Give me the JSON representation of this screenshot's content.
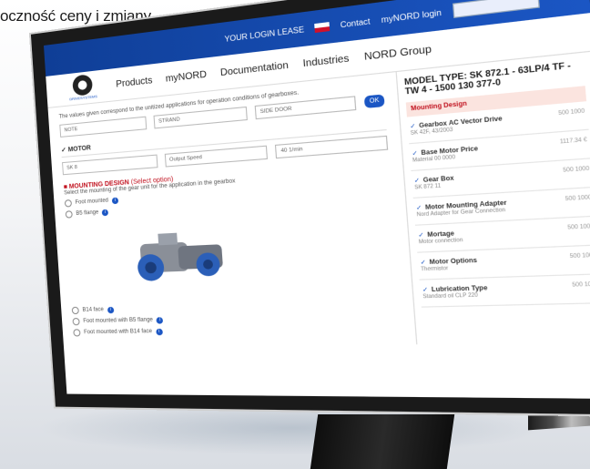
{
  "caption": "oczność ceny i zmiany",
  "topbar": {
    "links": [
      "YOUR LOGIN LEASE",
      "Contact",
      "myNORD login"
    ],
    "search_placeholder": ""
  },
  "nav": {
    "items": [
      "Products",
      "myNORD",
      "Documentation",
      "Industries",
      "NORD Group"
    ]
  },
  "main": {
    "intro": "The values given correspond to the unitized applications for operation conditions of gearboxes.",
    "fields": [
      "NOTE",
      "STRAND",
      "SIDE DOOR"
    ],
    "motor_section": "MOTOR",
    "motor_fields": [
      "SK 8",
      "Output Speed",
      "40 1/min"
    ],
    "mounting_section": "MOUNTING DESIGN",
    "mounting_note": "(Select option)",
    "mounting_desc": "Select the mounting of the gear unit for the application in the gearbox",
    "options_top": [
      "Foot mounted",
      "B5 flange"
    ],
    "options_bottom": [
      "B14 face",
      "Foot mounted with B5 flange",
      "Foot mounted with B14 face"
    ]
  },
  "side": {
    "title": "MODEL TYPE: SK 872.1 - 63LP/4 TF - TW 4 - 1500 130 377-0",
    "active": "Mounting Design",
    "items": [
      {
        "name": "Gearbox AC Vector Drive",
        "sub": "SK 42F, 43/2003",
        "val": "500 1000"
      },
      {
        "name": "Base Motor Price",
        "sub": "Material 00 0000",
        "val": "1117.34 €"
      },
      {
        "name": "Gear Box",
        "sub": "SK 872 11",
        "val": "500 1000"
      },
      {
        "name": "Motor Mounting Adapter",
        "sub": "Nord Adapter for Gear Connection",
        "val": "500 1000"
      },
      {
        "name": "Mortage",
        "sub": "Motor connection",
        "val": "500 1000"
      },
      {
        "name": "Motor Options",
        "sub": "Thermistor",
        "val": "500 1000"
      },
      {
        "name": "Lubrication Type",
        "sub": "Standard oil CLP 220",
        "val": "500 1000"
      }
    ]
  },
  "colors": {
    "primary": "#1b56c4",
    "accent": "#c1121f"
  }
}
